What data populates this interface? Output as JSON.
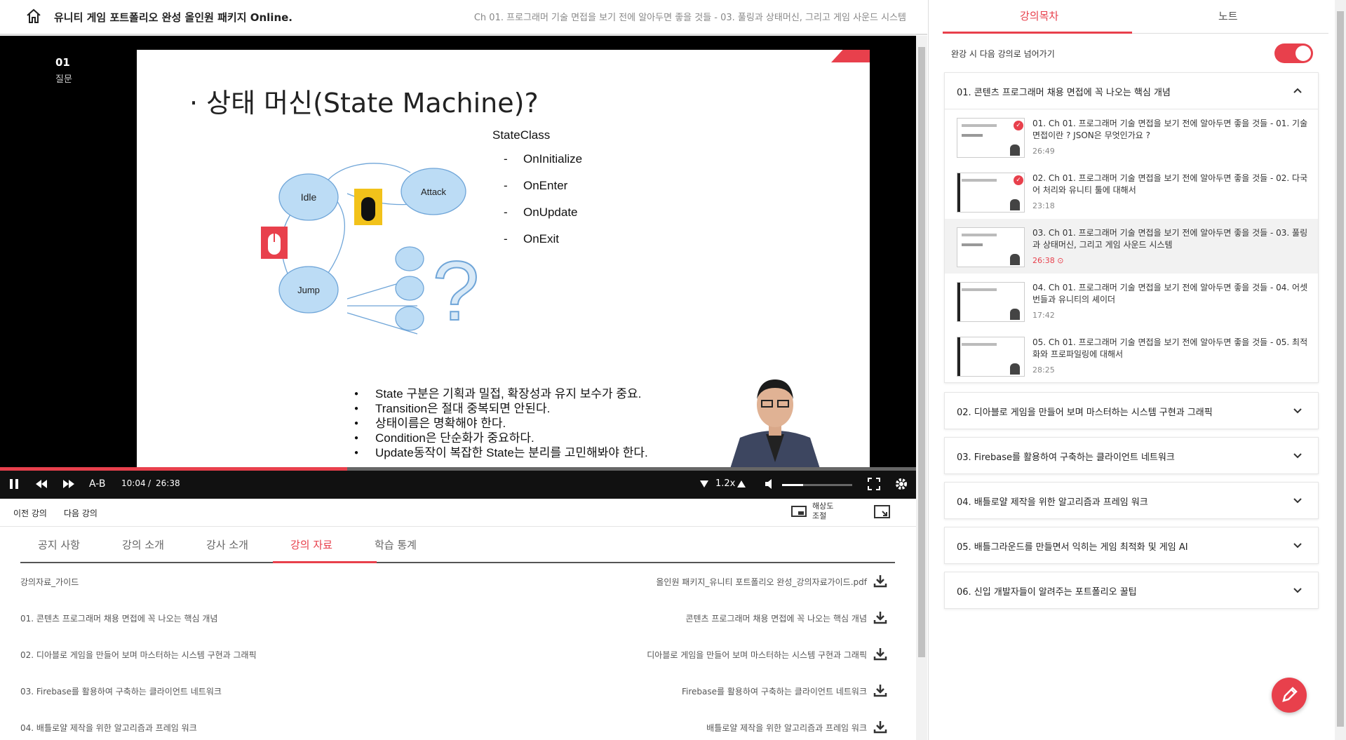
{
  "header": {
    "course_title": "유니티 게임 포트폴리오 완성 올인원 패키지 Online.",
    "chapter_title": "Ch 01. 프로그래머 기술 면접을 보기 전에 알아두면 좋을 것들 - 03. 풀링과 상태머신, 그리고 게임 사운드 시스템"
  },
  "player": {
    "lecture_number": "01",
    "lecture_sub": "질문",
    "slide": {
      "title": "· 상태 머신(State Machine)?",
      "nodes": [
        "Idle",
        "Attack",
        "Jump"
      ],
      "state_class_heading": "StateClass",
      "state_class_items": [
        "OnInitialize",
        "OnEnter",
        "OnUpdate",
        "OnExit"
      ],
      "bullets": [
        "State 구분은 기획과 밀접, 확장성과 유지 보수가 중요.",
        "Transition은 절대 중복되면 안된다.",
        "상태이름은 명확해야 한다.",
        "Condition은 단순화가 중요하다.",
        "Update동작이 복잡한 State는 분리를 고민해봐야 한다."
      ]
    },
    "progress_fraction": 0.379,
    "ab_label": "A-B",
    "current_time": "10:04",
    "time_sep": "/",
    "duration": "26:38",
    "speed": "1.2x",
    "volume_fraction": 0.3
  },
  "under_player": {
    "prev": "이전 강의",
    "next": "다음 강의",
    "resolution": "해상도 조절"
  },
  "tabs": [
    "공지 사항",
    "강의 소개",
    "강사 소개",
    "강의 자료",
    "학습 통계"
  ],
  "active_tab": "강의 자료",
  "materials": [
    {
      "left": "강의자료_가이드",
      "right": "올인원 패키지_유니티 포트폴리오 완성_강의자료가이드.pdf"
    },
    {
      "left": "01. 콘텐츠 프로그래머 채용 면접에 꼭 나오는 핵심 개념",
      "right": "콘텐츠 프로그래머 채용 면접에 꼭 나오는 핵심 개념"
    },
    {
      "left": "02. 디아블로 게임을 만들어 보며 마스터하는 시스템 구현과 그래픽",
      "right": "디아블로 게임을 만들어 보며 마스터하는 시스템 구현과 그래픽"
    },
    {
      "left": "03. Firebase를 활용하여 구축하는 클라이언트 네트워크",
      "right": "Firebase를 활용하여 구축하는 클라이언트 네트워크"
    },
    {
      "left": "04. 배틀로얄 제작을 위한 알고리즘과 프레임 워크",
      "right": "배틀로얄 제작을 위한 알고리즘과 프레임 워크"
    }
  ],
  "sidebar": {
    "tab_toc": "강의목차",
    "tab_notes": "노트",
    "autoplay_label": "완강 시 다음 강의로 넘어가기",
    "autoplay_on": true,
    "sections": [
      {
        "title": "01. 콘텐츠 프로그래머 채용 면접에 꼭 나오는 핵심 개념",
        "expanded": true,
        "lectures": [
          {
            "title": "01. Ch 01. 프로그래머 기술 면접을 보기 전에 알아두면 좋을 것들 - 01. 기술 면접이란 ? JSON은 무엇인가요 ?",
            "time": "26:49",
            "completed": true
          },
          {
            "title": "02. Ch 01. 프로그래머 기술 면접을 보기 전에 알아두면 좋을 것들 - 02. 다국어 처리와 유니티 툴에 대해서",
            "time": "23:18",
            "completed": true
          },
          {
            "title": "03. Ch 01. 프로그래머 기술 면접을 보기 전에 알아두면 좋을 것들 - 03. 풀링과 상태머신, 그리고 게임 사운드 시스템",
            "time": "26:38",
            "current": true
          },
          {
            "title": "04. Ch 01. 프로그래머 기술 면접을 보기 전에 알아두면 좋을 것들 - 04. 어셋번들과 유니티의 셰이더",
            "time": "17:42"
          },
          {
            "title": "05. Ch 01. 프로그래머 기술 면접을 보기 전에 알아두면 좋을 것들 - 05. 최적화와 프로파일링에 대해서",
            "time": "28:25"
          }
        ]
      },
      {
        "title": "02. 디아블로 게임을 만들어 보며 마스터하는 시스템 구현과 그래픽"
      },
      {
        "title": "03. Firebase를 활용하여 구축하는 클라이언트 네트워크"
      },
      {
        "title": "04. 배틀로얄 제작을 위한 알고리즘과 프레임 워크"
      },
      {
        "title": "05. 배틀그라운드를 만들면서 익히는 게임 최적화 및 게임 AI"
      },
      {
        "title": "06. 신입 개발자들이 알려주는 포트폴리오 꿀팁"
      }
    ]
  },
  "colors": {
    "accent": "#e8404c",
    "player_bg": "#000000",
    "node_fill": "#bcdcf5"
  },
  "icons": [
    "home-icon",
    "pause-icon",
    "rewind-icon",
    "fast-forward-icon",
    "speed-down-icon",
    "speed-up-icon",
    "volume-icon",
    "fullscreen-icon",
    "settings-icon",
    "resolution-icon",
    "pip-icon",
    "download-icon",
    "chevron-up-icon",
    "chevron-down-icon",
    "pencil-icon",
    "check-icon",
    "play-circle-icon"
  ]
}
